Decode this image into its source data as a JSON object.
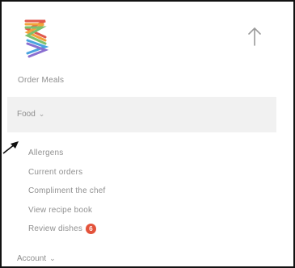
{
  "header": {
    "logo_icon": "stripes-logo-icon",
    "scroll_up_icon": "arrow-up-icon"
  },
  "app_title": "Order Meals",
  "food_section": {
    "label": "Food",
    "chevron": "chevron-down-icon"
  },
  "menu_items": [
    {
      "label": "Allergens"
    },
    {
      "label": "Current orders"
    },
    {
      "label": "Compliment the chef"
    },
    {
      "label": "View recipe book"
    },
    {
      "label": "Review dishes",
      "badge": "6"
    }
  ],
  "account_section": {
    "label": "Account",
    "chevron": "chevron-down-icon"
  },
  "colors": {
    "badge": "#e3533b",
    "header_bg": "#f1f1f1",
    "text": "#8e8e8e"
  }
}
